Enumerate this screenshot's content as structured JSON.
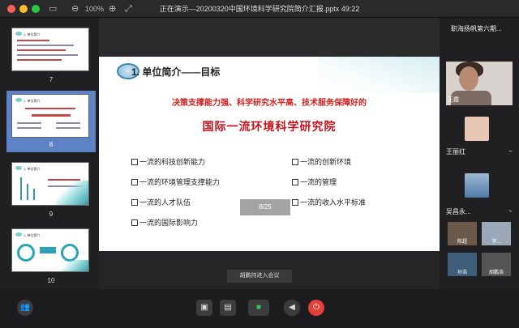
{
  "window": {
    "title": "正在演示—20200320中国环境科学研究院简介汇报.pptx 49:22",
    "zoom": "100%"
  },
  "thumbnails": [
    {
      "number": "7",
      "selected": false
    },
    {
      "number": "8",
      "selected": true
    },
    {
      "number": "9",
      "selected": false
    },
    {
      "number": "10",
      "selected": false
    }
  ],
  "slide": {
    "heading": "1. 单位简介——目标",
    "line1": "决策支撑能力强、科学研究水平高、技术服务保障好的",
    "line2": "国际一流环境科学研究院",
    "bullets_left": [
      "一流的科技创新能力",
      "一流的环境管理支撑能力",
      "一流的人才队伍",
      "一流的国际影响力"
    ],
    "bullets_right": [
      "一流的创新环境",
      "一流的管理",
      "一流的收入水平标准"
    ],
    "page_indicator": "8/25"
  },
  "notice": "胡鹏持进入会议",
  "participants_panel": {
    "title": "职海扬帆第六期...",
    "main": [
      {
        "name": "王霞",
        "type": "video"
      },
      {
        "name": "王丽红",
        "type": "avatar",
        "color": "#e8c7b4"
      },
      {
        "name": "吴昌永...",
        "type": "avatar",
        "color": "#4f7aa6"
      }
    ],
    "mini": [
      {
        "name": "陈超",
        "color": "#6b5a4a"
      },
      {
        "name": "李...",
        "color": "#9aa8b8"
      },
      {
        "name": "孙浩",
        "color": "#3d5d7a"
      },
      {
        "name": "胡鹏浩",
        "color": "#555"
      }
    ]
  },
  "toolbar": {
    "icons": [
      "participants-icon",
      "share-screen-icon",
      "folder-icon",
      "camera-icon",
      "speaker-icon",
      "end-call-icon"
    ]
  }
}
